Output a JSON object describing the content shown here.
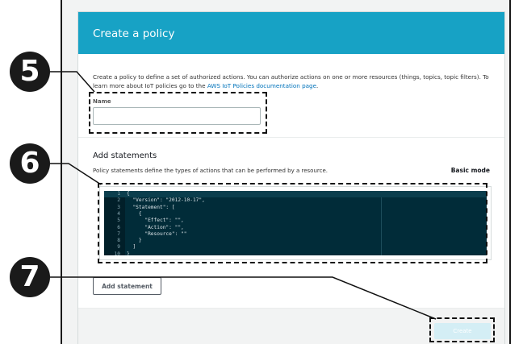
{
  "dialog": {
    "title": "Create a policy",
    "description": "Create a policy to define a set of authorized actions. You can authorize actions on one or more resources (things, topics, topic filters). To learn more about IoT policies go to the",
    "doc_link": "AWS IoT Policies documentation page",
    "description_end": ".",
    "name_label": "Name",
    "name_value": "",
    "statements_title": "Add statements",
    "statements_description": "Policy statements define the types of actions that can be performed by a resource.",
    "basic_mode_label": "Basic mode",
    "add_statement_label": "Add statement",
    "create_label": "Create"
  },
  "editor": {
    "lines": [
      {
        "n": "1",
        "code": "{"
      },
      {
        "n": "2",
        "code": "  \"Version\": \"2012-10-17\","
      },
      {
        "n": "3",
        "code": "  \"Statement\": ["
      },
      {
        "n": "4",
        "code": "    {"
      },
      {
        "n": "5",
        "code": "      \"Effect\": \"\","
      },
      {
        "n": "6",
        "code": "      \"Action\": \"\","
      },
      {
        "n": "7",
        "code": "      \"Resource\": \"\""
      },
      {
        "n": "8",
        "code": "    }"
      },
      {
        "n": "9",
        "code": "  ]"
      },
      {
        "n": "10",
        "code": "}"
      }
    ]
  },
  "callouts": {
    "step5": "5",
    "step6": "6",
    "step7": "7"
  },
  "colors": {
    "header": "#17a2c5",
    "editor_bg": "#012c39",
    "link": "#0073bb",
    "create_disabled": "#d4eef5"
  }
}
